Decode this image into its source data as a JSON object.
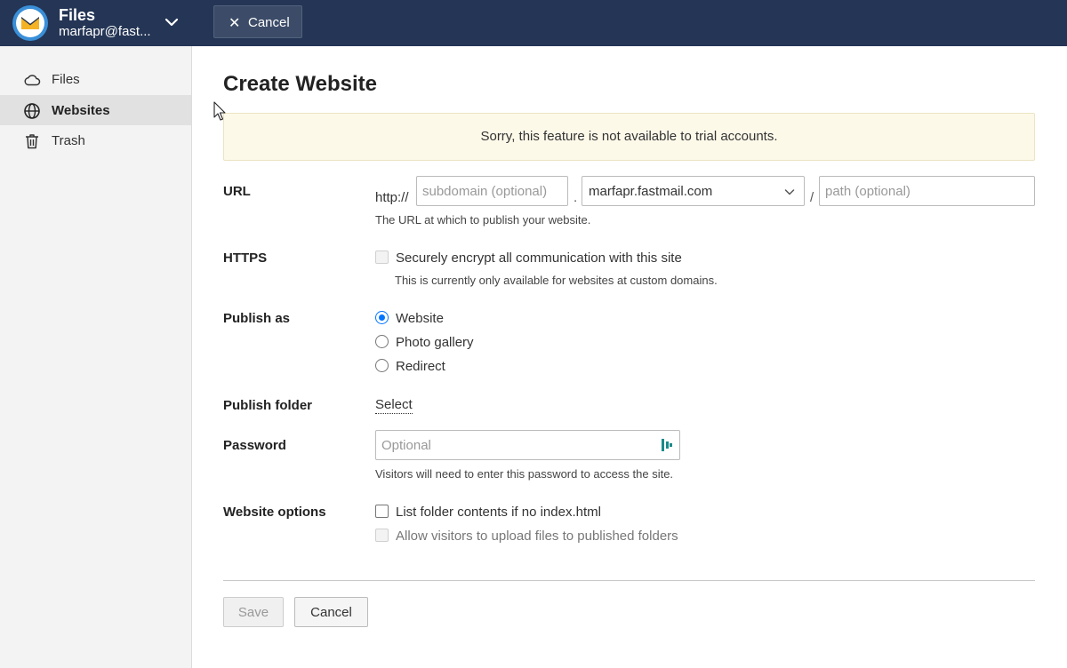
{
  "app": {
    "title": "Files",
    "account": "marfapr@fast...",
    "cancel_label": "Cancel"
  },
  "sidebar": {
    "items": [
      {
        "label": "Files",
        "icon": "cloud-icon",
        "active": false
      },
      {
        "label": "Websites",
        "icon": "globe-icon",
        "active": true
      },
      {
        "label": "Trash",
        "icon": "trash-icon",
        "active": false
      }
    ]
  },
  "form": {
    "title": "Create Website",
    "notice": "Sorry, this feature is not available to trial accounts.",
    "url": {
      "label": "URL",
      "prefix": "http://",
      "subdomain_placeholder": "subdomain (optional)",
      "dot": ".",
      "domain_value": "marfapr.fastmail.com",
      "slash": "/",
      "path_placeholder": "path (optional)",
      "help": "The URL at which to publish your website."
    },
    "https": {
      "label": "HTTPS",
      "checkbox_label": "Securely encrypt all communication with this site",
      "help": "This is currently only available for websites at custom domains."
    },
    "publish_as": {
      "label": "Publish as",
      "options": [
        {
          "label": "Website",
          "checked": true
        },
        {
          "label": "Photo gallery",
          "checked": false
        },
        {
          "label": "Redirect",
          "checked": false
        }
      ]
    },
    "publish_folder": {
      "label": "Publish folder",
      "link": "Select"
    },
    "password": {
      "label": "Password",
      "placeholder": "Optional",
      "help": "Visitors will need to enter this password to access the site."
    },
    "website_options": {
      "label": "Website options",
      "list_contents": "List folder contents if no index.html",
      "allow_upload": "Allow visitors to upload files to published folders"
    },
    "save_label": "Save",
    "cancel_label": "Cancel"
  },
  "colors": {
    "topbar": "#243555",
    "accent": "#0075ff",
    "notice_bg": "#fdf9e9"
  }
}
